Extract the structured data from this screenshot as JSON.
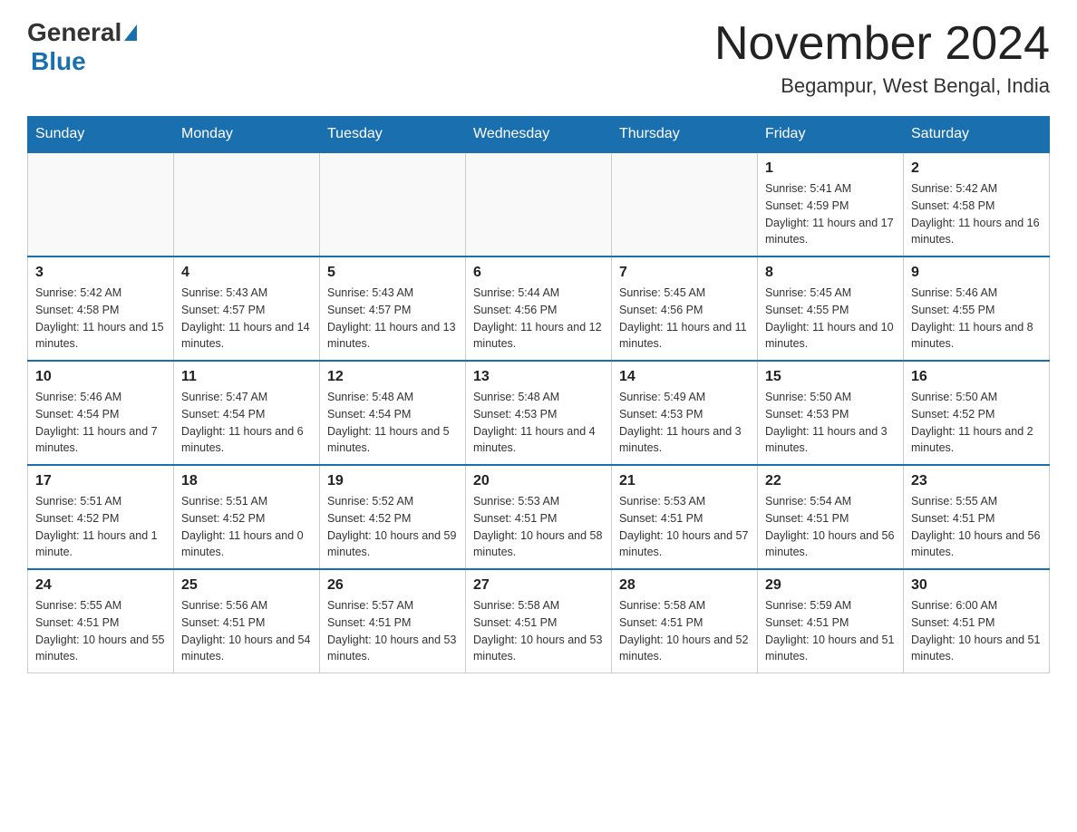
{
  "header": {
    "logo": {
      "general": "General",
      "blue": "Blue"
    },
    "title": "November 2024",
    "location": "Begampur, West Bengal, India"
  },
  "weekdays": [
    "Sunday",
    "Monday",
    "Tuesday",
    "Wednesday",
    "Thursday",
    "Friday",
    "Saturday"
  ],
  "weeks": [
    [
      {
        "day": "",
        "sunrise": "",
        "sunset": "",
        "daylight": ""
      },
      {
        "day": "",
        "sunrise": "",
        "sunset": "",
        "daylight": ""
      },
      {
        "day": "",
        "sunrise": "",
        "sunset": "",
        "daylight": ""
      },
      {
        "day": "",
        "sunrise": "",
        "sunset": "",
        "daylight": ""
      },
      {
        "day": "",
        "sunrise": "",
        "sunset": "",
        "daylight": ""
      },
      {
        "day": "1",
        "sunrise": "Sunrise: 5:41 AM",
        "sunset": "Sunset: 4:59 PM",
        "daylight": "Daylight: 11 hours and 17 minutes."
      },
      {
        "day": "2",
        "sunrise": "Sunrise: 5:42 AM",
        "sunset": "Sunset: 4:58 PM",
        "daylight": "Daylight: 11 hours and 16 minutes."
      }
    ],
    [
      {
        "day": "3",
        "sunrise": "Sunrise: 5:42 AM",
        "sunset": "Sunset: 4:58 PM",
        "daylight": "Daylight: 11 hours and 15 minutes."
      },
      {
        "day": "4",
        "sunrise": "Sunrise: 5:43 AM",
        "sunset": "Sunset: 4:57 PM",
        "daylight": "Daylight: 11 hours and 14 minutes."
      },
      {
        "day": "5",
        "sunrise": "Sunrise: 5:43 AM",
        "sunset": "Sunset: 4:57 PM",
        "daylight": "Daylight: 11 hours and 13 minutes."
      },
      {
        "day": "6",
        "sunrise": "Sunrise: 5:44 AM",
        "sunset": "Sunset: 4:56 PM",
        "daylight": "Daylight: 11 hours and 12 minutes."
      },
      {
        "day": "7",
        "sunrise": "Sunrise: 5:45 AM",
        "sunset": "Sunset: 4:56 PM",
        "daylight": "Daylight: 11 hours and 11 minutes."
      },
      {
        "day": "8",
        "sunrise": "Sunrise: 5:45 AM",
        "sunset": "Sunset: 4:55 PM",
        "daylight": "Daylight: 11 hours and 10 minutes."
      },
      {
        "day": "9",
        "sunrise": "Sunrise: 5:46 AM",
        "sunset": "Sunset: 4:55 PM",
        "daylight": "Daylight: 11 hours and 8 minutes."
      }
    ],
    [
      {
        "day": "10",
        "sunrise": "Sunrise: 5:46 AM",
        "sunset": "Sunset: 4:54 PM",
        "daylight": "Daylight: 11 hours and 7 minutes."
      },
      {
        "day": "11",
        "sunrise": "Sunrise: 5:47 AM",
        "sunset": "Sunset: 4:54 PM",
        "daylight": "Daylight: 11 hours and 6 minutes."
      },
      {
        "day": "12",
        "sunrise": "Sunrise: 5:48 AM",
        "sunset": "Sunset: 4:54 PM",
        "daylight": "Daylight: 11 hours and 5 minutes."
      },
      {
        "day": "13",
        "sunrise": "Sunrise: 5:48 AM",
        "sunset": "Sunset: 4:53 PM",
        "daylight": "Daylight: 11 hours and 4 minutes."
      },
      {
        "day": "14",
        "sunrise": "Sunrise: 5:49 AM",
        "sunset": "Sunset: 4:53 PM",
        "daylight": "Daylight: 11 hours and 3 minutes."
      },
      {
        "day": "15",
        "sunrise": "Sunrise: 5:50 AM",
        "sunset": "Sunset: 4:53 PM",
        "daylight": "Daylight: 11 hours and 3 minutes."
      },
      {
        "day": "16",
        "sunrise": "Sunrise: 5:50 AM",
        "sunset": "Sunset: 4:52 PM",
        "daylight": "Daylight: 11 hours and 2 minutes."
      }
    ],
    [
      {
        "day": "17",
        "sunrise": "Sunrise: 5:51 AM",
        "sunset": "Sunset: 4:52 PM",
        "daylight": "Daylight: 11 hours and 1 minute."
      },
      {
        "day": "18",
        "sunrise": "Sunrise: 5:51 AM",
        "sunset": "Sunset: 4:52 PM",
        "daylight": "Daylight: 11 hours and 0 minutes."
      },
      {
        "day": "19",
        "sunrise": "Sunrise: 5:52 AM",
        "sunset": "Sunset: 4:52 PM",
        "daylight": "Daylight: 10 hours and 59 minutes."
      },
      {
        "day": "20",
        "sunrise": "Sunrise: 5:53 AM",
        "sunset": "Sunset: 4:51 PM",
        "daylight": "Daylight: 10 hours and 58 minutes."
      },
      {
        "day": "21",
        "sunrise": "Sunrise: 5:53 AM",
        "sunset": "Sunset: 4:51 PM",
        "daylight": "Daylight: 10 hours and 57 minutes."
      },
      {
        "day": "22",
        "sunrise": "Sunrise: 5:54 AM",
        "sunset": "Sunset: 4:51 PM",
        "daylight": "Daylight: 10 hours and 56 minutes."
      },
      {
        "day": "23",
        "sunrise": "Sunrise: 5:55 AM",
        "sunset": "Sunset: 4:51 PM",
        "daylight": "Daylight: 10 hours and 56 minutes."
      }
    ],
    [
      {
        "day": "24",
        "sunrise": "Sunrise: 5:55 AM",
        "sunset": "Sunset: 4:51 PM",
        "daylight": "Daylight: 10 hours and 55 minutes."
      },
      {
        "day": "25",
        "sunrise": "Sunrise: 5:56 AM",
        "sunset": "Sunset: 4:51 PM",
        "daylight": "Daylight: 10 hours and 54 minutes."
      },
      {
        "day": "26",
        "sunrise": "Sunrise: 5:57 AM",
        "sunset": "Sunset: 4:51 PM",
        "daylight": "Daylight: 10 hours and 53 minutes."
      },
      {
        "day": "27",
        "sunrise": "Sunrise: 5:58 AM",
        "sunset": "Sunset: 4:51 PM",
        "daylight": "Daylight: 10 hours and 53 minutes."
      },
      {
        "day": "28",
        "sunrise": "Sunrise: 5:58 AM",
        "sunset": "Sunset: 4:51 PM",
        "daylight": "Daylight: 10 hours and 52 minutes."
      },
      {
        "day": "29",
        "sunrise": "Sunrise: 5:59 AM",
        "sunset": "Sunset: 4:51 PM",
        "daylight": "Daylight: 10 hours and 51 minutes."
      },
      {
        "day": "30",
        "sunrise": "Sunrise: 6:00 AM",
        "sunset": "Sunset: 4:51 PM",
        "daylight": "Daylight: 10 hours and 51 minutes."
      }
    ]
  ]
}
